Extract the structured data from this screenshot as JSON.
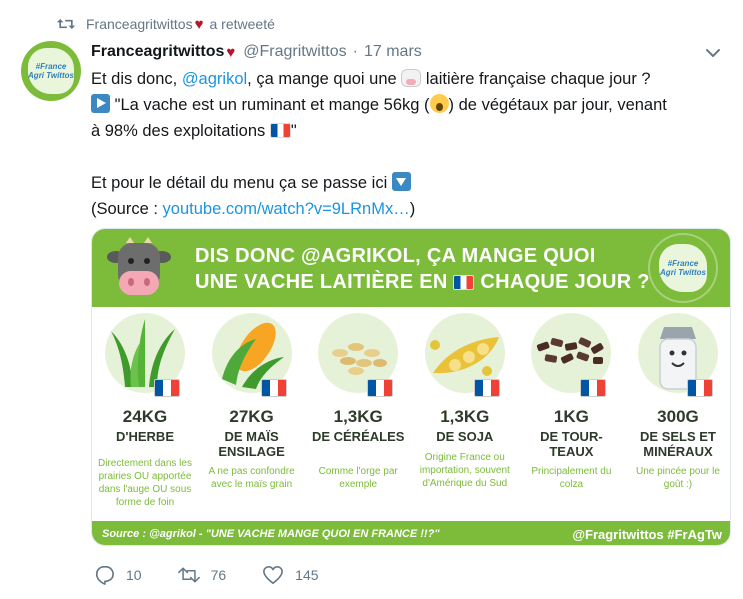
{
  "retweet": {
    "retweeter": "Franceagritwittos",
    "action": "a retweeté"
  },
  "tweet": {
    "display_name": "Franceagritwittos",
    "handle": "@Fragritwittos",
    "separator": "·",
    "date": "17 mars",
    "avatar_text": "#France Agri Twittos",
    "lines": {
      "l1_a": "Et dis donc, ",
      "l1_mention": "@agrikol",
      "l1_b": ", ça mange quoi une ",
      "l1_c": " laitière française chaque jour ?",
      "l2_a": " \"La vache est un ruminant et mange 56kg (",
      "l2_b": ") de végétaux par jour, venant",
      "l3_a": "à 98% des exploitations ",
      "l3_b": "\"",
      "l4": "Et pour le détail du menu ça se passe ici ",
      "l5_a": "(Source : ",
      "l5_link": "youtube.com/watch?v=9LRnMx…",
      "l5_b": ")"
    }
  },
  "card": {
    "title_line1": "DIS DONC @AGRIKOL, ÇA MANGE QUOI",
    "title_line2a": "UNE VACHE LAITIÈRE EN ",
    "title_line2b": " CHAQUE JOUR ?",
    "logo_text": "#France Agri Twittos",
    "items": [
      {
        "qty": "24KG",
        "what": "D'HERBE",
        "desc": "Directement dans les prairies OU apportée dans l'auge OU sous forme de foin"
      },
      {
        "qty": "27KG",
        "what": "DE MAÏS ENSILAGE",
        "desc": "A ne pas confondre avec le maïs grain"
      },
      {
        "qty": "1,3KG",
        "what": "DE CÉRÉALES",
        "desc": "Comme l'orge par exemple"
      },
      {
        "qty": "1,3KG",
        "what": "DE SOJA",
        "desc": "Origine France ou importation, souvent d'Amérique du Sud"
      },
      {
        "qty": "1KG",
        "what": "DE TOUR-TEAUX",
        "desc": "Principalement du colza"
      },
      {
        "qty": "300G",
        "what": "DE SELS ET MINÉRAUX",
        "desc": "Une pincée pour le goût :)"
      }
    ],
    "footer_source": "Source : @agrikol - \"UNE VACHE MANGE QUOI EN FRANCE !!?\"",
    "footer_tags": "@Fragritwittos #FrAgTw"
  },
  "actions": {
    "replies": "10",
    "retweets": "76",
    "likes": "145"
  },
  "colors": {
    "brand_green": "#7dbb3a",
    "link_blue": "#1b95e0",
    "muted": "#657786",
    "retweet_heart": "#b0172a"
  }
}
